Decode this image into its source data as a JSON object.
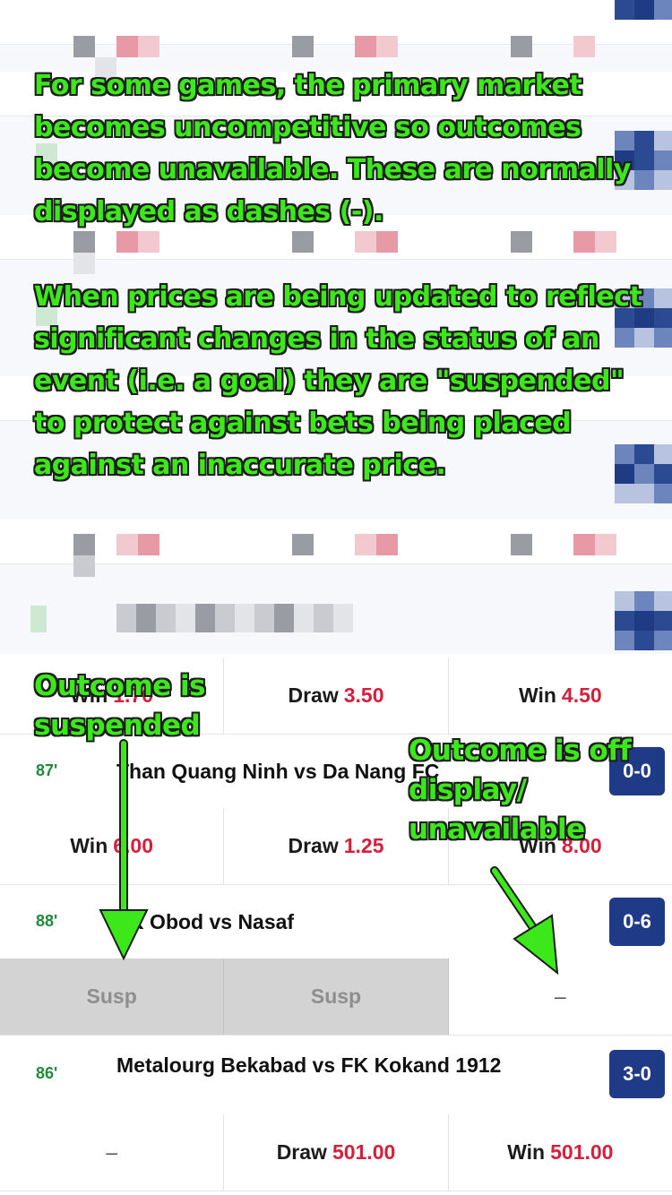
{
  "annotations": {
    "intro_paragraph_1": "For some games, the primary market becomes uncompetitive so outcomes become unavailable. These are normally displayed as dashes (-).",
    "intro_paragraph_2": "When prices are being updated to reflect significant changes in the status of an event (i.e. a goal) they are \"suspended\" to protect against bets being placed against an inaccurate price.",
    "suspended_note": "Outcome is suspended",
    "unavailable_note": "Outcome is off display/ unavailable",
    "highlight_color": "#3de81a",
    "arrow_color": "#3de81a"
  },
  "colors": {
    "price_red": "#d4203c",
    "minute_green": "#1e8a3a",
    "score_navy": "#1f3a86",
    "suspended_grey": "#d3d3d3"
  },
  "matches": [
    {
      "outcomes": [
        {
          "label": "Win",
          "price": "1.70",
          "state": "partially-covered"
        },
        {
          "label": "Draw",
          "price": "3.50",
          "state": "open"
        },
        {
          "label": "Win",
          "price": "4.50",
          "state": "open"
        }
      ]
    },
    {
      "minute": "87'",
      "teams": "Than Quang Ninh vs Da Nang FC",
      "score": "0-0",
      "outcomes": [
        {
          "label": "Win",
          "price": "6.00",
          "state": "open"
        },
        {
          "label": "Draw",
          "price": "1.25",
          "state": "open"
        },
        {
          "label": "Win",
          "price": "8.00",
          "state": "partially-covered"
        }
      ]
    },
    {
      "minute": "88'",
      "teams": "FK Obod vs Nasaf",
      "score": "0-6",
      "outcomes": [
        {
          "label": "Susp",
          "state": "suspended"
        },
        {
          "label": "Susp",
          "state": "suspended"
        },
        {
          "label": "–",
          "state": "unavailable"
        }
      ]
    },
    {
      "minute": "86'",
      "teams": "Metalourg Bekabad vs FK Kokand 1912",
      "score": "3-0",
      "outcomes": [
        {
          "label": "–",
          "state": "unavailable"
        },
        {
          "label": "Draw",
          "price": "501.00",
          "state": "open"
        },
        {
          "label": "Win",
          "price": "501.00",
          "state": "open"
        }
      ]
    }
  ]
}
